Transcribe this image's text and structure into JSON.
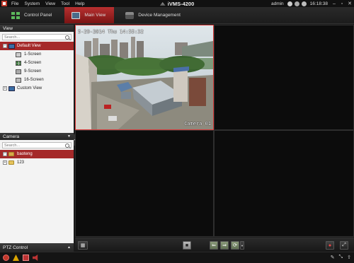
{
  "window": {
    "title": "iVMS-4200",
    "menu": [
      "File",
      "System",
      "View",
      "Tool",
      "Help"
    ],
    "user": "admin",
    "clock": "16:18:38",
    "controls": [
      "minimize",
      "maximize",
      "close"
    ]
  },
  "tabs": [
    {
      "label": "Control Panel",
      "icon": "control-panel-icon",
      "active": false
    },
    {
      "label": "Main View",
      "icon": "main-view-icon",
      "active": true
    },
    {
      "label": "Device Management",
      "icon": "device-management-icon",
      "active": false
    }
  ],
  "view_panel": {
    "header": "View",
    "search_placeholder": "Search...",
    "tree": [
      {
        "label": "Default View",
        "level": 0,
        "expanded": true,
        "selected": true
      },
      {
        "label": "1-Screen",
        "level": 1
      },
      {
        "label": "4-Screen",
        "level": 1
      },
      {
        "label": "9-Screen",
        "level": 1
      },
      {
        "label": "16-Screen",
        "level": 1
      },
      {
        "label": "Custom View",
        "level": 0,
        "expanded": false
      }
    ]
  },
  "camera_panel": {
    "header": "Camera",
    "search_placeholder": "Search...",
    "tree": [
      {
        "label": "baoteng",
        "selected": true
      },
      {
        "label": "123",
        "selected": false
      }
    ]
  },
  "ptz_panel": {
    "header": "PTZ Control"
  },
  "video": {
    "layout": "3x3",
    "active_cell": 0,
    "osd_timestamp": "5-29-2014 Thu 14:55:32",
    "camera_name": "Camera 01"
  },
  "colors": {
    "accent": "#a52a2a",
    "active_border": "#d83a3a",
    "panel_bg": "#f3f3f3"
  }
}
